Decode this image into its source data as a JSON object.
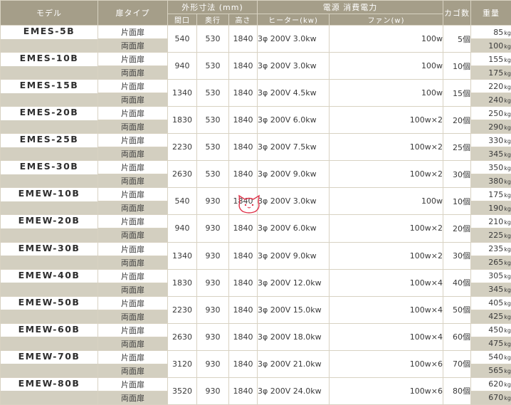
{
  "header": {
    "model": "モデル",
    "door_type": "扉タイプ",
    "dimensions": "外形寸法 (mm)",
    "width": "間口",
    "depth": "奥行",
    "height": "高さ",
    "power": "電源 消費電力",
    "heater": "ヒーター(kw)",
    "fan": "ファン(w)",
    "cage": "カゴ数",
    "weight": "重量"
  },
  "weight_unit": "kg",
  "rows": [
    {
      "model": "EMES-5B",
      "door1": "片面扉",
      "door2": "両面扉",
      "w": "540",
      "d": "530",
      "h": "1840",
      "heater": "3φ  200V  3.0kw",
      "fan": "100w",
      "cage": "5個",
      "wt1": "85",
      "wt2": "100"
    },
    {
      "model": "EMES-10B",
      "door1": "片面扉",
      "door2": "両面扉",
      "w": "940",
      "d": "530",
      "h": "1840",
      "heater": "3φ  200V  3.0kw",
      "fan": "100w",
      "cage": "10個",
      "wt1": "155",
      "wt2": "175"
    },
    {
      "model": "EMES-15B",
      "door1": "片面扉",
      "door2": "両面扉",
      "w": "1340",
      "d": "530",
      "h": "1840",
      "heater": "3φ  200V  4.5kw",
      "fan": "100w",
      "cage": "15個",
      "wt1": "220",
      "wt2": "240"
    },
    {
      "model": "EMES-20B",
      "door1": "片面扉",
      "door2": "両面扉",
      "w": "1830",
      "d": "530",
      "h": "1840",
      "heater": "3φ  200V  6.0kw",
      "fan": "100w×2",
      "cage": "20個",
      "wt1": "250",
      "wt2": "290"
    },
    {
      "model": "EMES-25B",
      "door1": "片面扉",
      "door2": "両面扉",
      "w": "2230",
      "d": "530",
      "h": "1840",
      "heater": "3φ  200V  7.5kw",
      "fan": "100w×2",
      "cage": "25個",
      "wt1": "330",
      "wt2": "345"
    },
    {
      "model": "EMES-30B",
      "door1": "片面扉",
      "door2": "両面扉",
      "w": "2630",
      "d": "530",
      "h": "1840",
      "heater": "3φ  200V  9.0kw",
      "fan": "100w×2",
      "cage": "30個",
      "wt1": "350",
      "wt2": "380"
    },
    {
      "model": "EMEW-10B",
      "door1": "片面扉",
      "door2": "両面扉",
      "w": "540",
      "d": "930",
      "h": "1840",
      "heater": "3φ  200V  3.0kw",
      "fan": "100w",
      "cage": "10個",
      "wt1": "175",
      "wt2": "190"
    },
    {
      "model": "EMEW-20B",
      "door1": "片面扉",
      "door2": "両面扉",
      "w": "940",
      "d": "930",
      "h": "1840",
      "heater": "3φ  200V  6.0kw",
      "fan": "100w×2",
      "cage": "20個",
      "wt1": "210",
      "wt2": "225"
    },
    {
      "model": "EMEW-30B",
      "door1": "片面扉",
      "door2": "両面扉",
      "w": "1340",
      "d": "930",
      "h": "1840",
      "heater": "3φ  200V  9.0kw",
      "fan": "100w×2",
      "cage": "30個",
      "wt1": "235",
      "wt2": "265"
    },
    {
      "model": "EMEW-40B",
      "door1": "片面扉",
      "door2": "両面扉",
      "w": "1830",
      "d": "930",
      "h": "1840",
      "heater": "3φ  200V 12.0kw",
      "fan": "100w×4",
      "cage": "40個",
      "wt1": "305",
      "wt2": "345"
    },
    {
      "model": "EMEW-50B",
      "door1": "片面扉",
      "door2": "両面扉",
      "w": "2230",
      "d": "930",
      "h": "1840",
      "heater": "3φ  200V 15.0kw",
      "fan": "100w×4",
      "cage": "50個",
      "wt1": "405",
      "wt2": "425"
    },
    {
      "model": "EMEW-60B",
      "door1": "片面扉",
      "door2": "両面扉",
      "w": "2630",
      "d": "930",
      "h": "1840",
      "heater": "3φ  200V 18.0kw",
      "fan": "100w×4",
      "cage": "60個",
      "wt1": "450",
      "wt2": "475"
    },
    {
      "model": "EMEW-70B",
      "door1": "片面扉",
      "door2": "両面扉",
      "w": "3120",
      "d": "930",
      "h": "1840",
      "heater": "3φ  200V 21.0kw",
      "fan": "100w×6",
      "cage": "70個",
      "wt1": "540",
      "wt2": "565"
    },
    {
      "model": "EMEW-80B",
      "door1": "片面扉",
      "door2": "両面扉",
      "w": "3520",
      "d": "930",
      "h": "1840",
      "heater": "3φ  200V 24.0kw",
      "fan": "100w×6",
      "cage": "80個",
      "wt1": "620",
      "wt2": "670"
    }
  ],
  "colors": {
    "header_bg": "#a59e89",
    "alt_row_bg": "#d3cfc0",
    "border": "#d8d2c2",
    "watermark": "#e0334a"
  },
  "icons": [
    "cat-watermark-icon"
  ]
}
